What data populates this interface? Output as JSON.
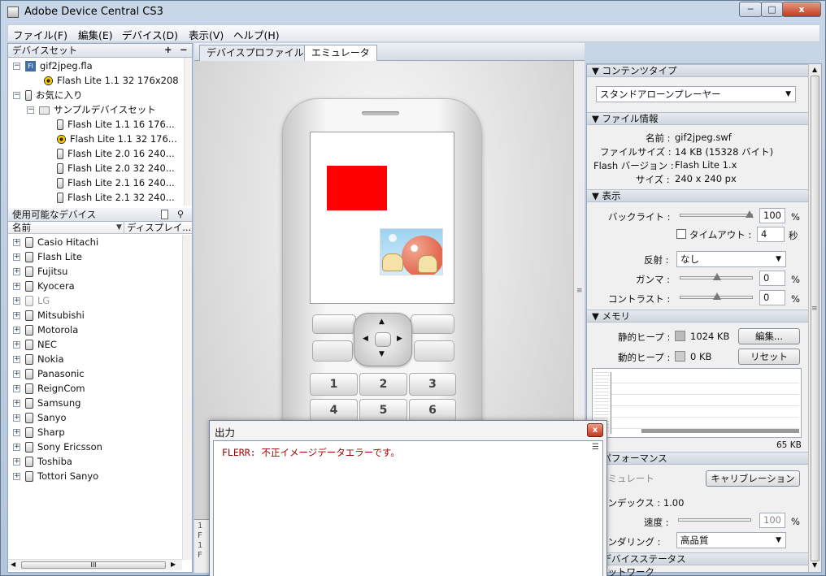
{
  "window": {
    "title": "Adobe Device Central CS3",
    "controls": {
      "minimize": "─",
      "maximize": "□",
      "close": "x"
    }
  },
  "menu": [
    "ファイル(F)",
    "編集(E)",
    "デバイス(D)",
    "表示(V)",
    "ヘルプ(H)"
  ],
  "device_sets": {
    "title": "デバイスセット",
    "add": "+",
    "remove": "−",
    "items": [
      {
        "label": "gif2jpeg.fla",
        "icon": "fla-file-icon"
      },
      {
        "label": "Flash Lite 1.1 32 176x208",
        "icon": "radiation-icon"
      },
      {
        "label": "お気に入り",
        "icon": "favorites-phone-icon"
      },
      {
        "label": "サンプルデバイスセット",
        "icon": "folder-icon"
      },
      {
        "label": "Flash Lite 1.1 16 176...",
        "icon": "phone-icon"
      },
      {
        "label": "Flash Lite 1.1 32 176...",
        "icon": "radiation-icon"
      },
      {
        "label": "Flash Lite 2.0 16 240...",
        "icon": "phone-icon"
      },
      {
        "label": "Flash Lite 2.0 32 240...",
        "icon": "phone-icon"
      },
      {
        "label": "Flash Lite 2.1 16 240...",
        "icon": "phone-icon"
      },
      {
        "label": "Flash Lite 2.1 32 240...",
        "icon": "phone-icon"
      }
    ]
  },
  "available_devices": {
    "title": "使用可能なデバイス",
    "col_name": "名前",
    "col_display": "ディスプレイ...",
    "items": [
      "Casio Hitachi",
      "Flash Lite",
      "Fujitsu",
      "Kyocera",
      "LG",
      "Mitsubishi",
      "Motorola",
      "NEC",
      "Nokia",
      "Panasonic",
      "ReignCom",
      "Samsung",
      "Sanyo",
      "Sharp",
      "Sony Ericsson",
      "Toshiba",
      "Tottori Sanyo"
    ],
    "disabled": [
      "LG"
    ],
    "hscroll_label": "III"
  },
  "tabs": [
    "デバイスプロファイル",
    "エミュレータ"
  ],
  "active_tab": 1,
  "phone": {
    "keys": [
      "1",
      "2",
      "3",
      "4",
      "5",
      "6"
    ],
    "shapes": {
      "red_rect": "#ff0000"
    }
  },
  "content_type": {
    "title": "コンテンツタイプ",
    "value": "スタンドアローンプレーヤー"
  },
  "file_info": {
    "title": "ファイル情報",
    "rows": [
      {
        "label": "名前 :",
        "value": "gif2jpeg.swf"
      },
      {
        "label": "ファイルサイズ :",
        "value": "14 KB (15328 バイト)"
      },
      {
        "label": "Flash バージョン :",
        "value": "Flash Lite 1.x"
      },
      {
        "label": "サイズ :",
        "value": "240 x 240 px"
      }
    ]
  },
  "display": {
    "title": "表示",
    "backlight_label": "バックライト :",
    "backlight_value": "100",
    "backlight_unit": "%",
    "timeout_label": "タイムアウト :",
    "timeout_value": "4",
    "timeout_unit": "秒",
    "reflection_label": "反射 :",
    "reflection_value": "なし",
    "gamma_label": "ガンマ :",
    "gamma_value": "0",
    "gamma_unit": "%",
    "contrast_label": "コントラスト :",
    "contrast_value": "0",
    "contrast_unit": "%"
  },
  "memory": {
    "title": "メモリ",
    "static_label": "静的ヒープ :",
    "static_value": "1024 KB",
    "edit_button": "編集...",
    "dynamic_label": "動的ヒープ :",
    "dynamic_value": "0 KB",
    "reset_button": "リセット",
    "graph_max": "65 KB"
  },
  "performance": {
    "title": "パフォーマンス",
    "emulate_label": "エミュレート",
    "calibrate_button": "キャリブレーション",
    "index_label": "インデックス : 1.00",
    "speed_label": "速度 :",
    "speed_value": "100",
    "speed_unit": "%",
    "rendering_label": "レンダリング :",
    "rendering_value": "高品質"
  },
  "device_status": {
    "title": "デバイスステータス",
    "network_label": "ネットワーク"
  },
  "output": {
    "title": "出力",
    "close": "x",
    "text": "FLERR: 不正イメージデータエラーです。",
    "bg_fragments": [
      "1",
      "F",
      "1",
      "F"
    ]
  }
}
